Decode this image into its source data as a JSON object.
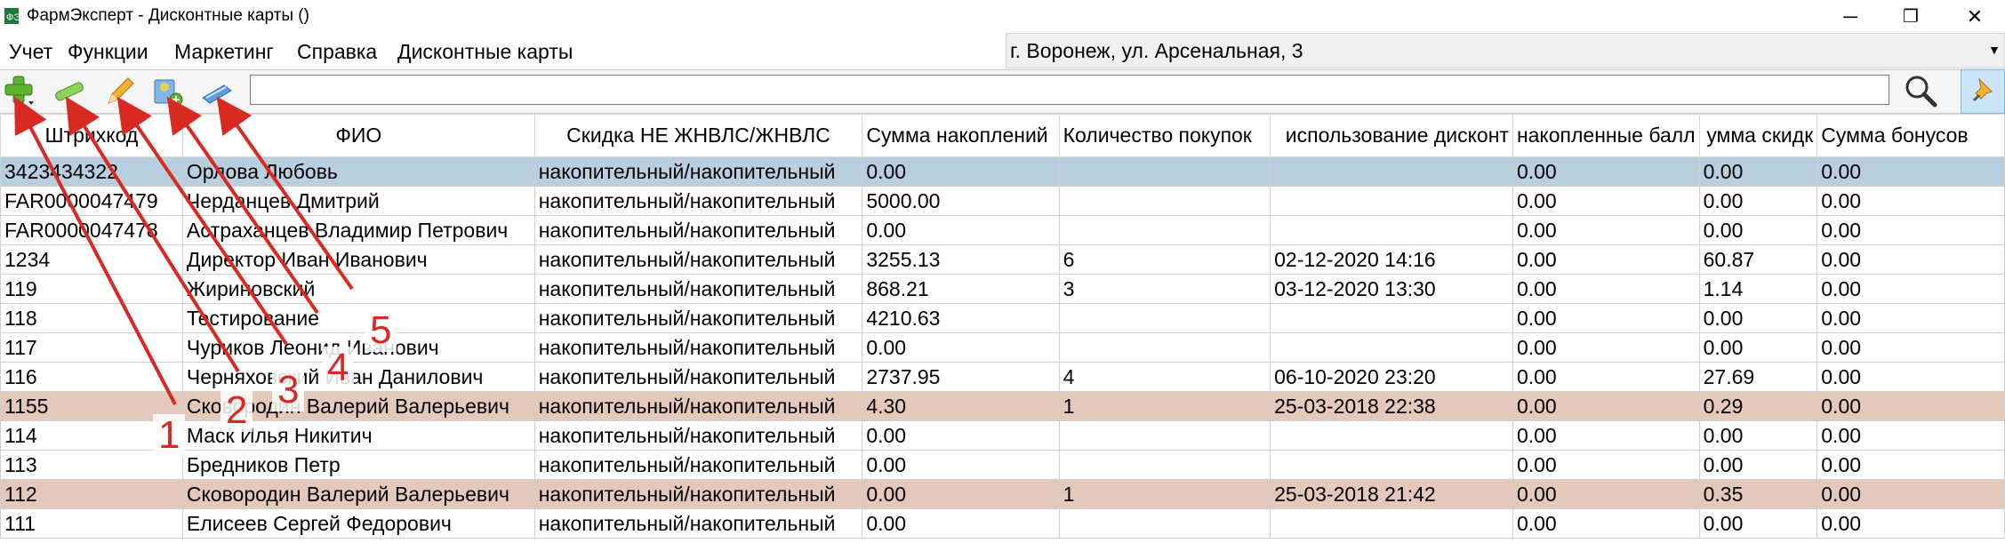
{
  "window": {
    "title": "ФармЭксперт - Дисконтные карты ()",
    "minimize": "─",
    "restore": "❐",
    "close": "✕",
    "app_icon": "pharmexpert-app-icon"
  },
  "menu": [
    "Учет",
    "Функции",
    "Маркетинг",
    "Справка",
    "Дисконтные карты"
  ],
  "pharmacy": {
    "selected": "г. Воронеж, ул. Арсенальная, 3",
    "arrow": "▼"
  },
  "toolbar": {
    "buttons": [
      "add-card-icon",
      "delete-card-icon",
      "edit-card-icon",
      "card-settings-icon",
      "discount-card-icon"
    ],
    "search_value": "",
    "search_icon": "magnifier-icon",
    "pin_icon": "pin-icon"
  },
  "table": {
    "headers": [
      "Штрихкод",
      "ФИО",
      "Скидка НЕ ЖНВЛС/ЖНВЛС",
      "Сумма накоплений",
      "Количество покупок",
      "использование дисконт",
      "накопленные балл",
      "умма скидк",
      "Сумма бонусов"
    ],
    "rows": [
      [
        "3423434322",
        "Орлова Любовь",
        "накопительный/накопительный",
        "0.00",
        "",
        "",
        "0.00",
        "0.00",
        "0.00"
      ],
      [
        "FAR0000047479",
        "Черданцев Дмитрий",
        "накопительный/накопительный",
        "5000.00",
        "",
        "",
        "0.00",
        "0.00",
        "0.00"
      ],
      [
        "FAR0000047478",
        "Астраханцев Владимир Петрович",
        "накопительный/накопительный",
        "0.00",
        "",
        "",
        "0.00",
        "0.00",
        "0.00"
      ],
      [
        "1234",
        "Директор Иван Иванович",
        "накопительный/накопительный",
        "3255.13",
        "6",
        "02-12-2020 14:16",
        "0.00",
        "60.87",
        "0.00"
      ],
      [
        "119",
        "Жириновский",
        "накопительный/накопительный",
        "868.21",
        "3",
        "03-12-2020 13:30",
        "0.00",
        "1.14",
        "0.00"
      ],
      [
        "118",
        "Тестирование",
        "накопительный/накопительный",
        "4210.63",
        "",
        "",
        "0.00",
        "0.00",
        "0.00"
      ],
      [
        "117",
        "Чуриков Леонид Иванович",
        "накопительный/накопительный",
        "0.00",
        "",
        "",
        "0.00",
        "0.00",
        "0.00"
      ],
      [
        "116",
        "Черняховский Иван Данилович",
        "накопительный/накопительный",
        "2737.95",
        "4",
        "06-10-2020 23:20",
        "0.00",
        "27.69",
        "0.00"
      ],
      [
        "1155",
        "Сковородин Валерий Валерьевич",
        "накопительный/накопительный",
        "4.30",
        "1",
        "25-03-2018 22:38",
        "0.00",
        "0.29",
        "0.00"
      ],
      [
        "114",
        "Маск Илья Никитич",
        "накопительный/накопительный",
        "0.00",
        "",
        "",
        "0.00",
        "0.00",
        "0.00"
      ],
      [
        "113",
        "Бредников Петр",
        "накопительный/накопительный",
        "0.00",
        "",
        "",
        "0.00",
        "0.00",
        "0.00"
      ],
      [
        "112",
        "Сковородин Валерий Валерьевич",
        "накопительный/накопительный",
        "0.00",
        "1",
        "25-03-2018 21:42",
        "0.00",
        "0.35",
        "0.00"
      ],
      [
        "111",
        "Елисеев Сергей Федорович",
        "накопительный/накопительный",
        "0.00",
        "",
        "",
        "0.00",
        "0.00",
        "0.00"
      ]
    ]
  },
  "annotations": {
    "labels": [
      "1",
      "2",
      "3",
      "4",
      "5"
    ],
    "color": "#d82a22"
  },
  "colors": {
    "selected_row": "#b9cfde",
    "highlighted_row": "#e4c8bc"
  }
}
